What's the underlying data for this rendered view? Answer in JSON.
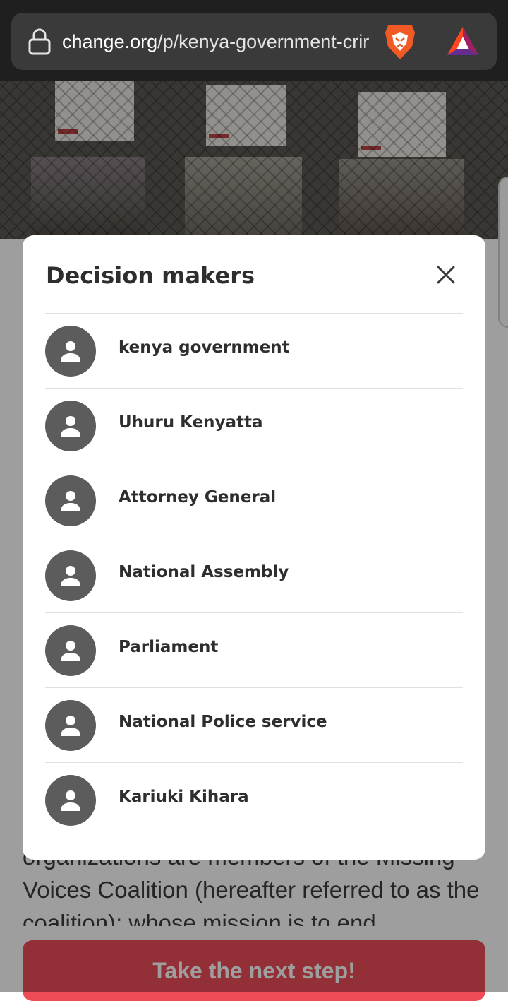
{
  "browser": {
    "url_domain": "change.org",
    "url_path": "/p/kenya-government-crir"
  },
  "page": {
    "body_text": "organizations are members of the Missing Voices Coalition (hereafter referred to as the coalition): whose mission is to end",
    "cta_label": "Take the next step!"
  },
  "modal": {
    "title": "Decision makers",
    "items": [
      {
        "name": "kenya government"
      },
      {
        "name": "Uhuru Kenyatta"
      },
      {
        "name": "Attorney General"
      },
      {
        "name": "National Assembly"
      },
      {
        "name": "Parliament"
      },
      {
        "name": "National Police service"
      },
      {
        "name": "Kariuki Kihara"
      }
    ]
  },
  "colors": {
    "cta": "#ee4d58",
    "avatar": "#5c5c5c",
    "browser_bar": "#1f1f1f"
  },
  "icons": [
    "lock-icon",
    "brave-lion-icon",
    "bat-triangle-icon",
    "close-icon",
    "person-icon"
  ]
}
